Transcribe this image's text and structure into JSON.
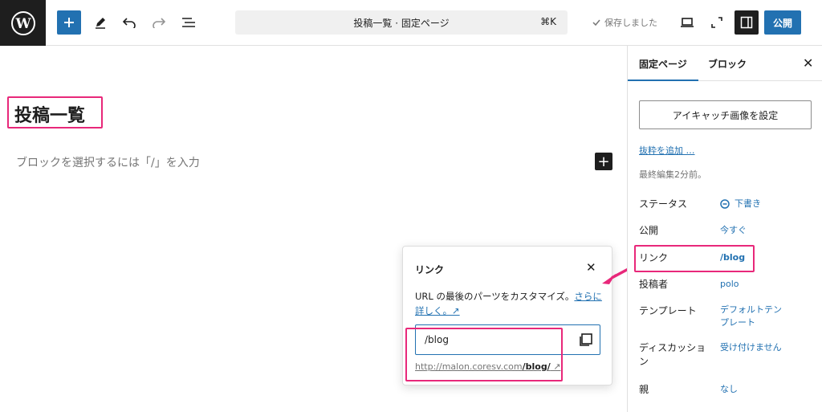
{
  "toolbar": {
    "document_title": "投稿一覧 · 固定ページ",
    "shortcut": "⌘K",
    "saved_status": "保存しました",
    "publish_label": "公開"
  },
  "editor": {
    "page_title": "投稿一覧",
    "block_placeholder": "ブロックを選択するには「/」を入力"
  },
  "sidebar": {
    "tabs": [
      "固定ページ",
      "ブロック"
    ],
    "featured_image_label": "アイキャッチ画像を設定",
    "add_excerpt": "抜粋を追加 …",
    "last_edited": "最終編集2分前。",
    "rows": [
      {
        "label": "ステータス",
        "value": "下書き"
      },
      {
        "label": "公開",
        "value": "今すぐ"
      },
      {
        "label": "リンク",
        "value": "/blog"
      },
      {
        "label": "投稿者",
        "value": "polo"
      },
      {
        "label": "テンプレート",
        "value": "デフォルトテンプレート"
      },
      {
        "label": "ディスカッション",
        "value": "受け付けません"
      },
      {
        "label": "親",
        "value": "なし"
      }
    ]
  },
  "link_popover": {
    "title": "リンク",
    "description": "URL の最後のパーツをカスタマイズ。",
    "learn_more": "さらに詳しく。↗",
    "slug_value": "/blog",
    "url_prefix": "http://malon.coresv.com",
    "url_slug": "/blog/",
    "url_suffix": " ↗"
  },
  "colors": {
    "accent": "#2271b1",
    "highlight": "#e8287a",
    "dark": "#1e1e1e"
  }
}
